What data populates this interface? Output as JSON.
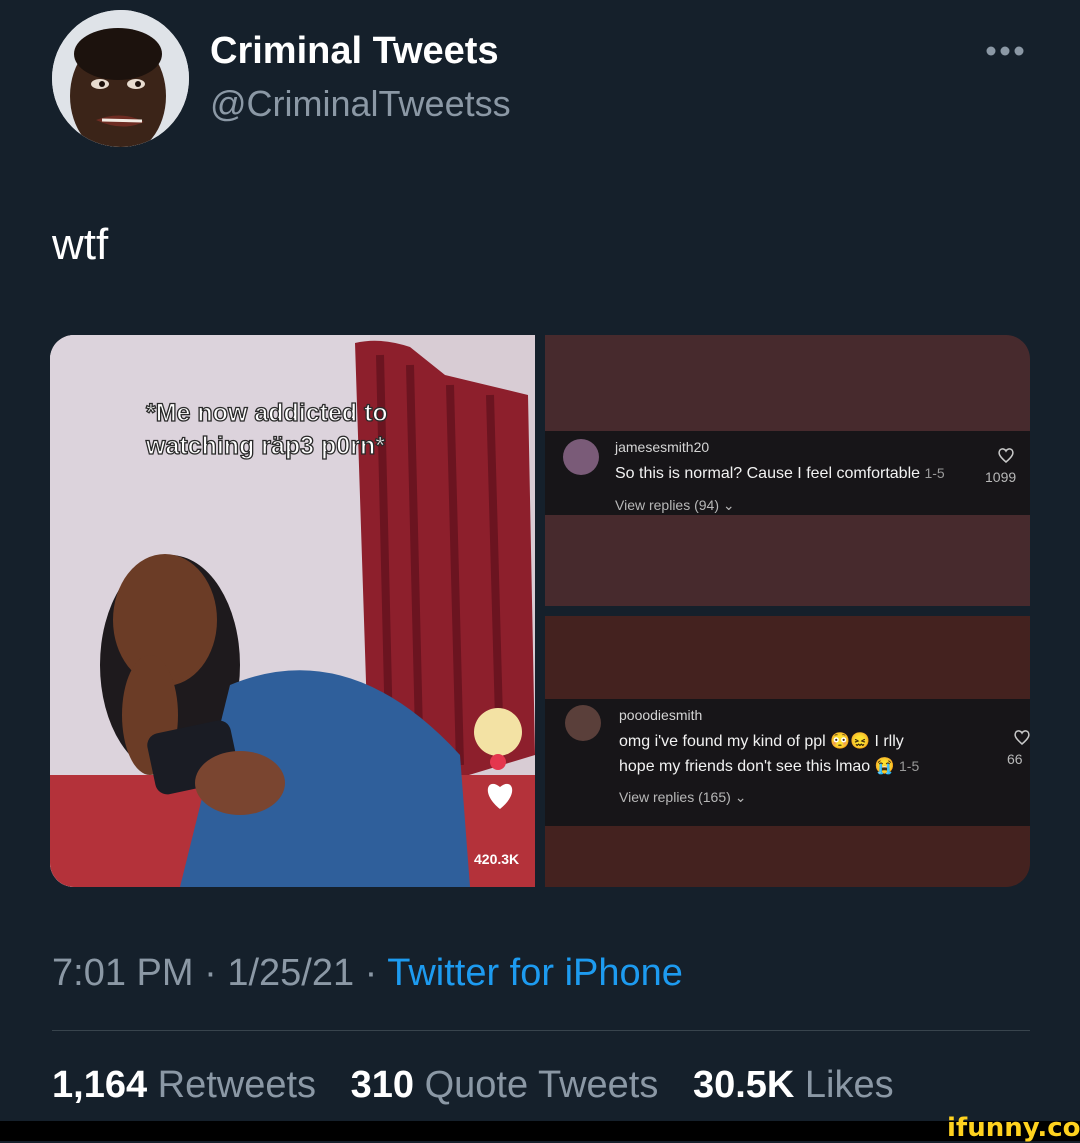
{
  "tweet": {
    "display_name": "Criminal Tweets",
    "handle": "@CriminalTweetss",
    "text": "wtf",
    "time": "7:01 PM",
    "sep1": "·",
    "date": "1/25/21",
    "sep2": "·",
    "source": "Twitter for iPhone",
    "retweets": "1,164",
    "retweets_label": "Retweets",
    "quotes": "310",
    "quotes_label": "Quote Tweets",
    "likes": "30.5K",
    "likes_label": "Likes"
  },
  "media": {
    "left_caption_line1": "*Me now addicted to",
    "left_caption_line2": "watching räp3 p0rn*",
    "left_like_count": "420.3K",
    "comment1": {
      "user": "jamesesmith20",
      "text": "So this is normal? Cause I feel comfortable",
      "meta": "1-5",
      "likes": "1099",
      "replies": "View replies (94)"
    },
    "comment2": {
      "user": "pooodiesmith",
      "text_line1": "omg i've found my kind of ppl 😳😖 I rlly",
      "text_line2": "hope my friends don't see this lmao 😭",
      "meta": "1-5",
      "likes": "66",
      "replies": "View replies (165)"
    }
  },
  "watermark": "ifunny.co",
  "colors": {
    "background": "#15202b",
    "secondary_text": "#8b98a5",
    "link": "#1d9bf0",
    "watermark": "#ffd21f"
  }
}
